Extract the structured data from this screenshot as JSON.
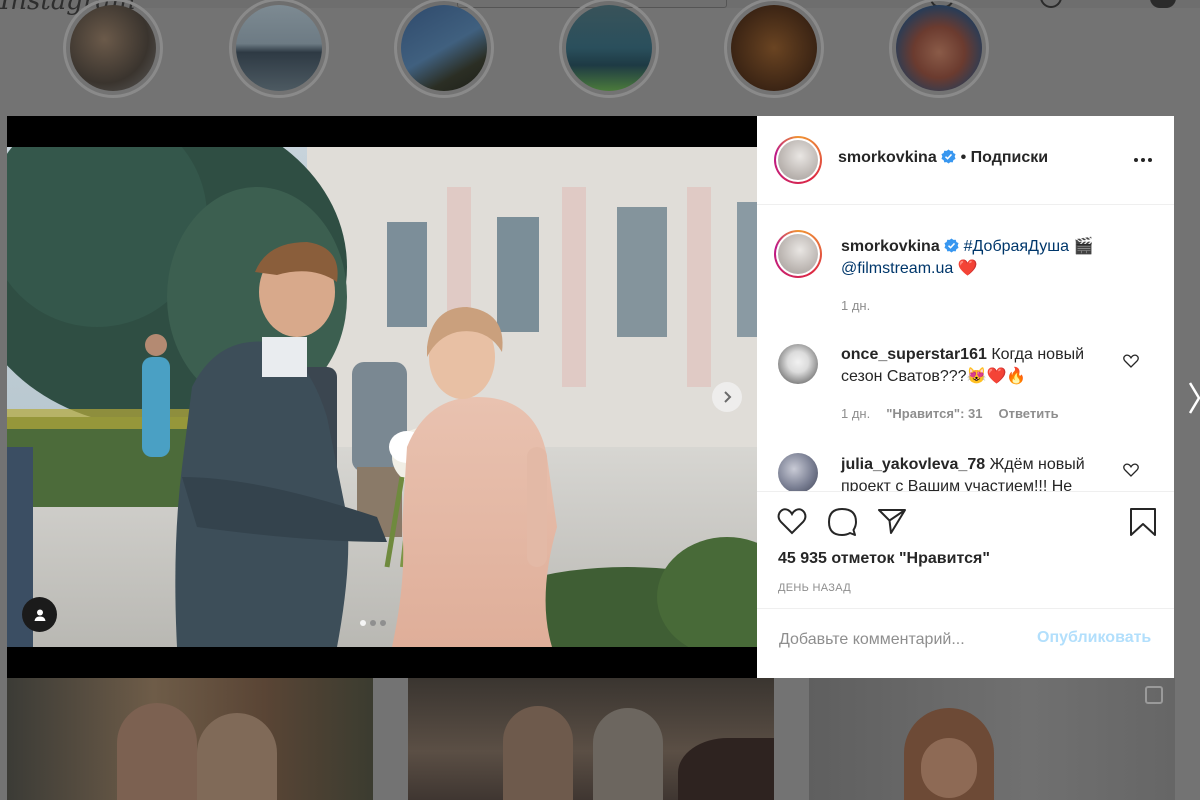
{
  "app": {
    "logo_text": "Instagram"
  },
  "post": {
    "author": "smorkovkina",
    "follow_label": "• Подписки",
    "caption_hashtag": "#ДобраяДуша",
    "caption_emoji_1": "🎬",
    "caption_mention": "@filmstream.ua",
    "caption_emoji_2": "❤️",
    "caption_time": "1 дн.",
    "carousel_active_index": 1,
    "carousel_count": 3,
    "likes": "45 935 отметок \"Нравится\"",
    "posted_ago": "ДЕНЬ НАЗАД",
    "comment_placeholder": "Добавьте комментарий...",
    "publish_label": "Опубликовать"
  },
  "comments": [
    {
      "user": "once_superstar161",
      "text": "Когда новый сезон Сватов???😻❤️🔥",
      "time": "1 дн.",
      "likes": "\"Нравится\": 31",
      "reply": "Ответить"
    },
    {
      "user": "julia_yakovleva_78",
      "text": "Ждём новый проект с Вашим участием!!! Не"
    }
  ],
  "icons": {
    "more": "more-horizontal-icon",
    "verified": "verified-badge-icon",
    "like": "heart-icon",
    "comment": "comment-icon",
    "share": "share-icon",
    "save": "bookmark-icon",
    "next": "chevron-right-icon",
    "tag": "user-tag-icon"
  },
  "colors": {
    "verified": "#3897f0",
    "link": "#00376b",
    "publish_disabled": "#b2dffc",
    "overlay": "#737373"
  }
}
